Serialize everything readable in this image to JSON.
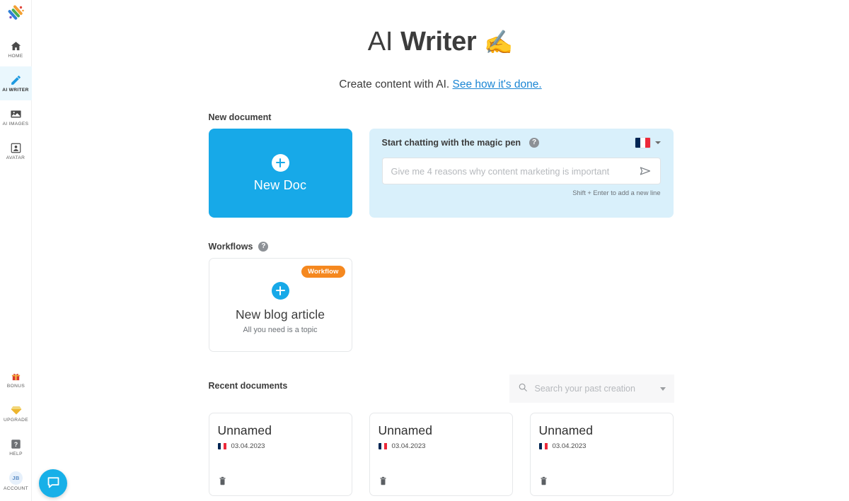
{
  "app": {
    "logo_icon": "app-logo-stripes"
  },
  "sidebar": {
    "top_items": [
      {
        "label": "HOME",
        "icon": "home-icon",
        "active": false
      },
      {
        "label": "AI WRITER",
        "icon": "pencil-icon",
        "active": true
      },
      {
        "label": "AI IMAGES",
        "icon": "image-icon",
        "active": false
      },
      {
        "label": "AVATAR",
        "icon": "avatar-icon",
        "active": false
      }
    ],
    "bottom_items": [
      {
        "label": "BONUS",
        "icon": "gift-icon"
      },
      {
        "label": "UPGRADE",
        "icon": "diamond-icon"
      },
      {
        "label": "HELP",
        "icon": "question-box-icon"
      },
      {
        "label": "ACCOUNT",
        "icon": "user-avatar-icon",
        "initials": "JB"
      }
    ],
    "support_button": {
      "icon": "chat-bubble-icon"
    }
  },
  "header": {
    "title_light": "AI",
    "title_bold": "Writer",
    "title_emoji": "✍️",
    "subtitle_text": "Create content with AI.",
    "subtitle_link": "See how it's done."
  },
  "new_document": {
    "heading": "New document",
    "new_doc_card": {
      "label": "New Doc",
      "plus_icon": "plus-icon"
    },
    "magic_pen": {
      "heading": "Start chatting with the magic pen",
      "help_icon": "question-circle-icon",
      "language": {
        "flag": "flag-france",
        "caret_icon": "chevron-down-icon"
      },
      "input_value": "",
      "input_placeholder": "Give me 4 reasons why content marketing is important",
      "send_icon": "send-icon",
      "hint": "Shift + Enter to add a new line"
    }
  },
  "workflows": {
    "heading": "Workflows",
    "help_icon": "question-circle-icon",
    "cards": [
      {
        "badge": "Workflow",
        "title": "New blog article",
        "subtitle": "All you need is a topic",
        "plus_icon": "plus-icon"
      }
    ]
  },
  "recent_documents": {
    "heading": "Recent documents",
    "search": {
      "icon": "search-icon",
      "value": "",
      "placeholder": "Search your past creation",
      "caret_icon": "chevron-down-icon"
    },
    "cards": [
      {
        "title": "Unnamed",
        "flag": "flag-france",
        "date": "03.04.2023",
        "delete_icon": "trash-icon"
      },
      {
        "title": "Unnamed",
        "flag": "flag-france",
        "date": "03.04.2023",
        "delete_icon": "trash-icon"
      },
      {
        "title": "Unnamed",
        "flag": "flag-france",
        "date": "03.04.2023",
        "delete_icon": "trash-icon"
      }
    ]
  },
  "colors": {
    "accent_blue": "#17a9e8",
    "panel_blue": "#d9f0fb",
    "badge_orange": "#f5881f",
    "link_blue": "#1b86d4",
    "text_dark": "#3c3c3c"
  }
}
